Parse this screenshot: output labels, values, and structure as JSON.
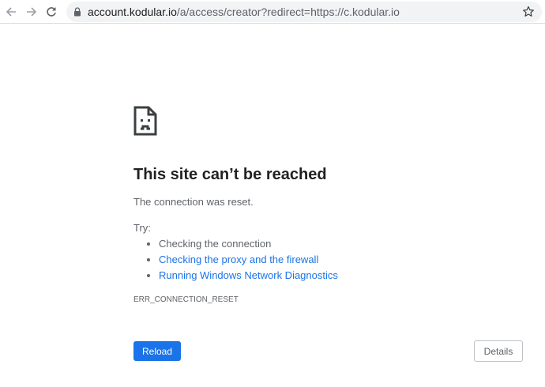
{
  "browser": {
    "back_icon": "arrow-left-icon",
    "forward_icon": "arrow-right-icon",
    "reload_icon": "reload-icon",
    "lock_icon": "lock-icon",
    "bookmark_icon": "star-icon",
    "url_host": "account.kodular.io",
    "url_path": "/a/access/creator?redirect=https://c.kodular.io"
  },
  "error_page": {
    "icon": "sad-document-icon",
    "title": "This site can’t be reached",
    "message": "The connection was reset.",
    "try_label": "Try:",
    "suggestions": [
      "Checking the connection",
      "Checking the proxy and the firewall",
      "Running Windows Network Diagnostics"
    ],
    "error_code": "ERR_CONNECTION_RESET",
    "reload_label": "Reload",
    "details_label": "Details",
    "colors": {
      "primary": "#1a73e8",
      "text": "#202124",
      "secondary_text": "#5f6368"
    }
  }
}
